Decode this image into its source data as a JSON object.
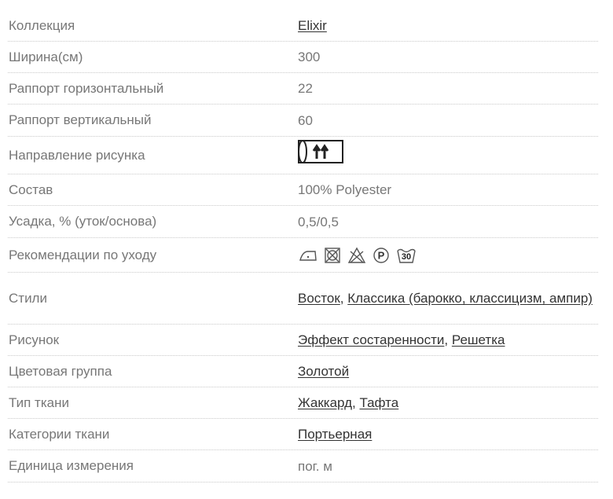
{
  "rows": [
    {
      "label": "Коллекция",
      "links": [
        "Elixir"
      ]
    },
    {
      "label": "Ширина(см)",
      "value": "300"
    },
    {
      "label": "Раппорт горизонтальный",
      "value": "22"
    },
    {
      "label": "Раппорт вертикальный",
      "value": "60"
    },
    {
      "label": "Направление рисунка",
      "icon": "pattern-direction-roll-arrows-up-icon"
    },
    {
      "label": "Состав",
      "value": "100% Polyester"
    },
    {
      "label": "Усадка, % (уток/основа)",
      "value": "0,5/0,5"
    },
    {
      "label": "Рекомендации по уходу",
      "care_icons": [
        "iron-low-icon",
        "no-tumble-dry-icon",
        "no-bleach-icon",
        "dry-clean-p-icon",
        "wash-30-icon"
      ],
      "care_wash_text": "30",
      "care_p_text": "P"
    },
    {
      "label": "Стили",
      "links": [
        "Восток",
        "Классика (барокко, классицизм, ампир)"
      ]
    },
    {
      "label": "Рисунок",
      "links": [
        "Эффект состаренности",
        "Решетка"
      ]
    },
    {
      "label": "Цветовая группа",
      "links": [
        "Золотой"
      ]
    },
    {
      "label": "Тип ткани",
      "links": [
        "Жаккард",
        "Тафта"
      ]
    },
    {
      "label": "Категории ткани",
      "links": [
        "Портьерная"
      ]
    },
    {
      "label": "Единица измерения",
      "value": "пог. м"
    }
  ],
  "separator": ", "
}
